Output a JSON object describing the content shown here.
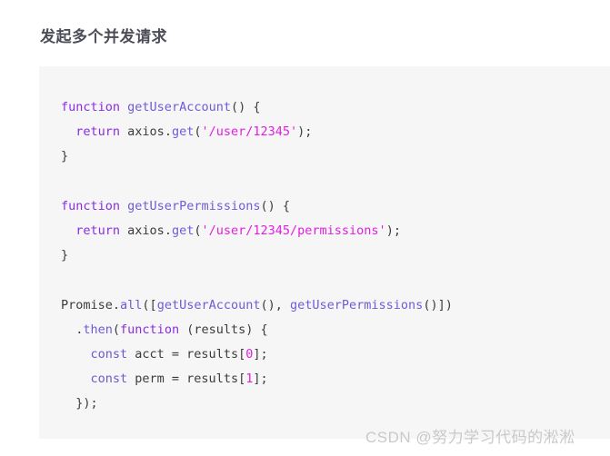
{
  "page": {
    "title": "发起多个并发请求",
    "background_color": "#ffffff"
  },
  "code_block": {
    "background_color": "#f6f6f6",
    "language": "javascript",
    "plain_text": "function getUserAccount() {\n  return axios.get('/user/12345');\n}\n\nfunction getUserPermissions() {\n  return axios.get('/user/12345/permissions');\n}\n\nPromise.all([getUserAccount(), getUserPermissions()])\n  .then(function (results) {\n    const acct = results[0];\n    const perm = results[1];\n  });",
    "lines": [
      {
        "index": 1,
        "tokens": [
          {
            "t": "function",
            "k": "kw"
          },
          {
            "t": " ",
            "k": "plain"
          },
          {
            "t": "getUserAccount",
            "k": "fn"
          },
          {
            "t": "() {",
            "k": "plain"
          }
        ]
      },
      {
        "index": 2,
        "tokens": [
          {
            "t": "  ",
            "k": "plain"
          },
          {
            "t": "return",
            "k": "kw"
          },
          {
            "t": " axios.",
            "k": "plain"
          },
          {
            "t": "get",
            "k": "fn"
          },
          {
            "t": "(",
            "k": "plain"
          },
          {
            "t": "'/user/12345'",
            "k": "str"
          },
          {
            "t": ");",
            "k": "plain"
          }
        ]
      },
      {
        "index": 3,
        "tokens": [
          {
            "t": "}",
            "k": "plain"
          }
        ]
      },
      {
        "index": 4,
        "tokens": []
      },
      {
        "index": 5,
        "tokens": [
          {
            "t": "function",
            "k": "kw"
          },
          {
            "t": " ",
            "k": "plain"
          },
          {
            "t": "getUserPermissions",
            "k": "fn"
          },
          {
            "t": "() {",
            "k": "plain"
          }
        ]
      },
      {
        "index": 6,
        "tokens": [
          {
            "t": "  ",
            "k": "plain"
          },
          {
            "t": "return",
            "k": "kw"
          },
          {
            "t": " axios.",
            "k": "plain"
          },
          {
            "t": "get",
            "k": "fn"
          },
          {
            "t": "(",
            "k": "plain"
          },
          {
            "t": "'/user/12345/permissions'",
            "k": "str"
          },
          {
            "t": ");",
            "k": "plain"
          }
        ]
      },
      {
        "index": 7,
        "tokens": [
          {
            "t": "}",
            "k": "plain"
          }
        ]
      },
      {
        "index": 8,
        "tokens": []
      },
      {
        "index": 9,
        "tokens": [
          {
            "t": "Promise.",
            "k": "plain"
          },
          {
            "t": "all",
            "k": "fn"
          },
          {
            "t": "([",
            "k": "plain"
          },
          {
            "t": "getUserAccount",
            "k": "fn"
          },
          {
            "t": "(), ",
            "k": "plain"
          },
          {
            "t": "getUserPermissions",
            "k": "fn"
          },
          {
            "t": "()])",
            "k": "plain"
          }
        ]
      },
      {
        "index": 10,
        "tokens": [
          {
            "t": "  .",
            "k": "plain"
          },
          {
            "t": "then",
            "k": "fn"
          },
          {
            "t": "(",
            "k": "plain"
          },
          {
            "t": "function",
            "k": "kw"
          },
          {
            "t": " (results) {",
            "k": "plain"
          }
        ]
      },
      {
        "index": 11,
        "tokens": [
          {
            "t": "    ",
            "k": "plain"
          },
          {
            "t": "const",
            "k": "kw2"
          },
          {
            "t": " acct = results[",
            "k": "plain"
          },
          {
            "t": "0",
            "k": "num"
          },
          {
            "t": "];",
            "k": "plain"
          }
        ]
      },
      {
        "index": 12,
        "tokens": [
          {
            "t": "    ",
            "k": "plain"
          },
          {
            "t": "const",
            "k": "kw2"
          },
          {
            "t": " perm = results[",
            "k": "plain"
          },
          {
            "t": "1",
            "k": "num"
          },
          {
            "t": "];",
            "k": "plain"
          }
        ]
      },
      {
        "index": 13,
        "tokens": [
          {
            "t": "  });",
            "k": "plain"
          }
        ]
      }
    ]
  },
  "watermark": {
    "text": "CSDN @努力学习代码的淞淞",
    "color": "#c9c9cc"
  },
  "syntax_colors": {
    "keyword": "#8b2be2",
    "keyword_declaration": "#6a5acd",
    "function_name": "#6f5bd8",
    "string": "#e020e0",
    "number": "#e020e0",
    "plain": "#3b3b3b"
  }
}
